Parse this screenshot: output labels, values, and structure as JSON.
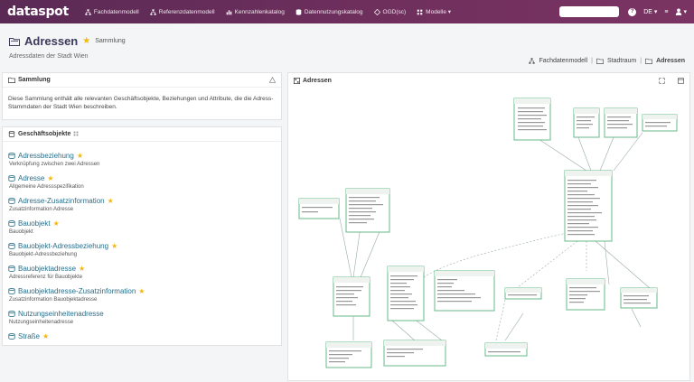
{
  "app": {
    "logo": "dataspot"
  },
  "nav": [
    {
      "label": "Fachdatenmodell",
      "icon": "sitemap-icon"
    },
    {
      "label": "Referenzdatenmodell",
      "icon": "sitemap-icon"
    },
    {
      "label": "Kennzahlenkatalog",
      "icon": "chart-icon"
    },
    {
      "label": "Datennutzungskatalog",
      "icon": "database-icon"
    },
    {
      "label": "OGD(sc)",
      "icon": "diamond-icon"
    },
    {
      "label": "Modelle ▾",
      "icon": "grid-icon"
    }
  ],
  "topright": {
    "lang": "DE ▾",
    "help": "?",
    "menu": "≡",
    "user": "▾"
  },
  "header": {
    "title": "Adressen",
    "type": "Sammlung",
    "description": "Adressdaten der Stadt Wien",
    "breadcrumb": [
      "Fachdatenmodell",
      "Stadtraum",
      "Adressen"
    ]
  },
  "sammlung": {
    "title": "Sammlung",
    "text": "Diese Sammlung enthält alle relevanten Geschäftsobjekte, Beziehungen und Attribute, die die Adress-Stammdaten der Stadt Wien beschreiben."
  },
  "geschaeftsobjekte": {
    "title": "Geschäftsobjekte",
    "items": [
      {
        "title": "Adressbeziehung",
        "sub": "Verknüpfung zwischen zwei Adressen"
      },
      {
        "title": "Adresse",
        "sub": "Allgemeine Adressspezifikation"
      },
      {
        "title": "Adresse-Zusatzinformation",
        "sub": "Zusatzinformation Adresse"
      },
      {
        "title": "Bauobjekt",
        "sub": "Bauobjekt"
      },
      {
        "title": "Bauobjekt-Adressbeziehung",
        "sub": "Bauobjekt-Adressbeziehung"
      },
      {
        "title": "Bauobjektadresse",
        "sub": "Adressreferenz für Bauobjekte"
      },
      {
        "title": "Bauobjektadresse-Zusatzinformation",
        "sub": "Zusatzinformation Bauobjektadresse"
      },
      {
        "title": "Nutzungseinheitenadresse",
        "sub": "Nutzungseinheitenadresse"
      },
      {
        "title": "Straße",
        "sub": ""
      }
    ]
  },
  "diagram": {
    "title": "Adressen"
  }
}
